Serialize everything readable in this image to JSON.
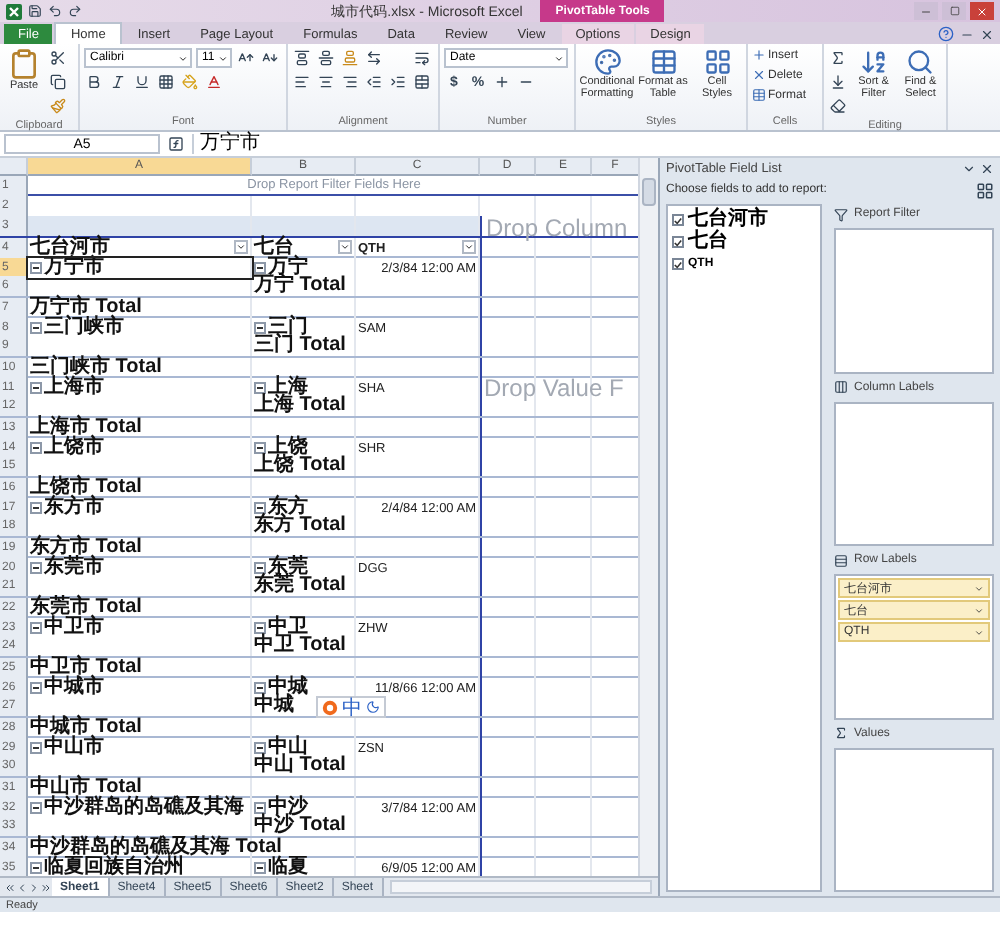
{
  "window": {
    "title": "城市代码.xlsx - Microsoft Excel",
    "context_tab": "PivotTable Tools"
  },
  "ribbon_tabs": [
    {
      "label": "File",
      "kind": "file",
      "selected": false
    },
    {
      "label": "Home",
      "kind": "normal",
      "selected": true
    },
    {
      "label": "Insert",
      "kind": "normal",
      "selected": false
    },
    {
      "label": "Page Layout",
      "kind": "normal",
      "selected": false
    },
    {
      "label": "Formulas",
      "kind": "normal",
      "selected": false
    },
    {
      "label": "Data",
      "kind": "normal",
      "selected": false
    },
    {
      "label": "Review",
      "kind": "normal",
      "selected": false
    },
    {
      "label": "View",
      "kind": "normal",
      "selected": false
    },
    {
      "label": "Options",
      "kind": "context",
      "selected": false
    },
    {
      "label": "Design",
      "kind": "context",
      "selected": false
    }
  ],
  "ribbon_groups": [
    {
      "label": "Clipboard",
      "kind": "clipboard",
      "buttons": [
        "Paste"
      ]
    },
    {
      "label": "Font",
      "kind": "font",
      "font_name": "Calibri",
      "font_size": "11"
    },
    {
      "label": "Alignment",
      "kind": "alignment"
    },
    {
      "label": "Number",
      "kind": "number",
      "format": "Date",
      "symbols": [
        "$",
        "%"
      ]
    },
    {
      "label": "Styles",
      "kind": "large",
      "buttons": [
        "Conditional Formatting",
        "Format as Table",
        "Cell Styles"
      ]
    },
    {
      "label": "Cells",
      "kind": "small",
      "buttons": [
        "Insert",
        "Delete",
        "Format"
      ]
    },
    {
      "label": "Editing",
      "kind": "editing",
      "buttons": [
        "Sort & Filter",
        "Find & Select"
      ]
    }
  ],
  "formula_bar": {
    "name_box": "A5",
    "value": "万宁市"
  },
  "columns": [
    {
      "label": "A",
      "selected": true
    },
    {
      "label": "B",
      "selected": false
    },
    {
      "label": "C",
      "selected": false
    },
    {
      "label": "D",
      "selected": false
    },
    {
      "label": "E",
      "selected": false
    },
    {
      "label": "F",
      "selected": false
    }
  ],
  "rows": [
    {
      "number": "1",
      "kind": "filter",
      "text": "Drop Report Filter Fields Here"
    },
    {
      "number": "2",
      "kind": "blank"
    },
    {
      "number": "3",
      "kind": "band"
    },
    {
      "number": "4",
      "kind": "header",
      "cells": [
        "七台河市",
        "七台",
        "QTH"
      ]
    },
    {
      "number": "5",
      "kind": "item",
      "a": "万宁市",
      "b": "万宁",
      "c": "2/3/84 12:00 AM",
      "right_aligned": true,
      "selected": true
    },
    {
      "number": "6",
      "kind": "subtotal",
      "b": "万宁 Total"
    },
    {
      "number": "7",
      "kind": "total",
      "a": "万宁市 Total"
    },
    {
      "number": "8",
      "kind": "item",
      "a": "三门峡市",
      "b": "三门",
      "c": "SAM",
      "right_aligned": false,
      "selected": false
    },
    {
      "number": "9",
      "kind": "subtotal",
      "b": "三门 Total"
    },
    {
      "number": "10",
      "kind": "total",
      "a": "三门峡市 Total"
    },
    {
      "number": "11",
      "kind": "item",
      "a": "上海市",
      "b": "上海",
      "c": "SHA",
      "right_aligned": false,
      "selected": false
    },
    {
      "number": "12",
      "kind": "subtotal",
      "b": "上海 Total"
    },
    {
      "number": "13",
      "kind": "total",
      "a": "上海市 Total"
    },
    {
      "number": "14",
      "kind": "item",
      "a": "上饶市",
      "b": "上饶",
      "c": "SHR",
      "right_aligned": false,
      "selected": false
    },
    {
      "number": "15",
      "kind": "subtotal",
      "b": "上饶 Total"
    },
    {
      "number": "16",
      "kind": "total",
      "a": "上饶市 Total"
    },
    {
      "number": "17",
      "kind": "item",
      "a": "东方市",
      "b": "东方",
      "c": "2/4/84 12:00 AM",
      "right_aligned": true,
      "selected": false
    },
    {
      "number": "18",
      "kind": "subtotal",
      "b": "东方 Total"
    },
    {
      "number": "19",
      "kind": "total",
      "a": "东方市 Total"
    },
    {
      "number": "20",
      "kind": "item",
      "a": "东莞市",
      "b": "东莞",
      "c": "DGG",
      "right_aligned": false,
      "selected": false
    },
    {
      "number": "21",
      "kind": "subtotal",
      "b": "东莞 Total"
    },
    {
      "number": "22",
      "kind": "total",
      "a": "东莞市 Total"
    },
    {
      "number": "23",
      "kind": "item",
      "a": "中卫市",
      "b": "中卫",
      "c": "ZHW",
      "right_aligned": false,
      "selected": false
    },
    {
      "number": "24",
      "kind": "subtotal",
      "b": "中卫 Total"
    },
    {
      "number": "25",
      "kind": "total",
      "a": "中卫市 Total"
    },
    {
      "number": "26",
      "kind": "item",
      "a": "中城市",
      "b": "中城",
      "c": "11/8/66 12:00 AM",
      "right_aligned": true,
      "selected": false
    },
    {
      "number": "27",
      "kind": "subtotal",
      "b": "中城"
    },
    {
      "number": "28",
      "kind": "total",
      "a": "中城市 Total"
    },
    {
      "number": "29",
      "kind": "item",
      "a": "中山市",
      "b": "中山",
      "c": "ZSN",
      "right_aligned": false,
      "selected": false
    },
    {
      "number": "30",
      "kind": "subtotal",
      "b": "中山 Total"
    },
    {
      "number": "31",
      "kind": "total",
      "a": "中山市 Total"
    },
    {
      "number": "32",
      "kind": "item",
      "a": "中沙群岛的岛礁及其海",
      "b": "中沙",
      "c": "3/7/84 12:00 AM",
      "right_aligned": true,
      "selected": false
    },
    {
      "number": "33",
      "kind": "subtotal",
      "b": "中沙 Total"
    },
    {
      "number": "34",
      "kind": "total",
      "a": "中沙群岛的岛礁及其海 Total"
    },
    {
      "number": "35",
      "kind": "item",
      "a": "临夏回族自治州",
      "b": "临夏",
      "c": "6/9/05 12:00 AM",
      "right_aligned": true,
      "selected": false
    }
  ],
  "drop_zones": {
    "column": "Drop Column",
    "value": "Drop Value F"
  },
  "ime_toolbar": {
    "label": "中"
  },
  "sheet_tabs": [
    {
      "label": "Sheet1",
      "selected": true
    },
    {
      "label": "Sheet4",
      "selected": false
    },
    {
      "label": "Sheet5",
      "selected": false
    },
    {
      "label": "Sheet6",
      "selected": false
    },
    {
      "label": "Sheet2",
      "selected": false
    },
    {
      "label": "Sheet",
      "selected": false
    }
  ],
  "status_bar": {
    "text": "Ready"
  },
  "field_list": {
    "title": "PivotTable Field List",
    "prompt": "Choose fields to add to report:",
    "fields": [
      {
        "label": "七台河市",
        "checked": true
      },
      {
        "label": "七台",
        "checked": true
      },
      {
        "label": "QTH",
        "checked": true
      }
    ],
    "areas": [
      {
        "label": "Report Filter",
        "kind": "filter"
      },
      {
        "label": "Column Labels",
        "kind": "columns"
      },
      {
        "label": "Row Labels",
        "kind": "rows",
        "items": [
          "七台河市",
          "七台",
          "QTH"
        ]
      },
      {
        "label": "Values",
        "kind": "values"
      }
    ]
  }
}
